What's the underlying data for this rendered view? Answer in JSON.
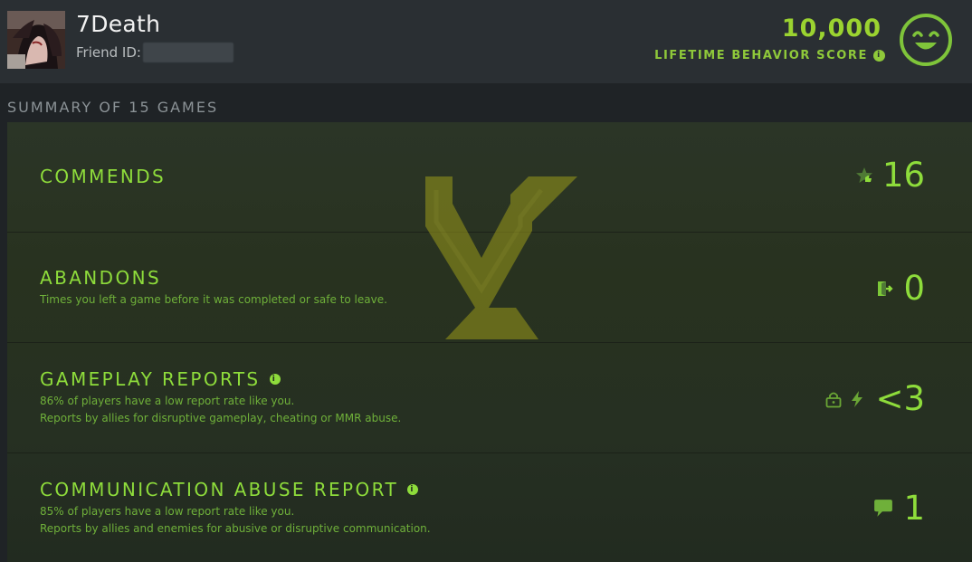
{
  "profile": {
    "name": "7Death",
    "friend_id_label": "Friend ID:",
    "avatar_icon": "player-portrait"
  },
  "behavior": {
    "score": "10,000",
    "label": "LIFETIME BEHAVIOR SCORE",
    "mood_icon": "smiley-face-icon"
  },
  "summary": {
    "title": "SUMMARY OF 15 GAMES",
    "watermark_icon": "chevron-emblem"
  },
  "cards": [
    {
      "title": "COMMENDS",
      "descriptions": [],
      "value": "16",
      "icons": [
        "star-thumbs-up-icon"
      ]
    },
    {
      "title": "ABANDONS",
      "descriptions": [
        "Times you left a game before it was completed or safe to leave."
      ],
      "value": "0",
      "icons": [
        "exit-door-icon"
      ]
    },
    {
      "title": "GAMEPLAY REPORTS",
      "descriptions": [
        "86% of players have a low report rate like you.",
        "Reports by allies for disruptive gameplay, cheating or MMR abuse."
      ],
      "value": "<3",
      "icons": [
        "lock-icon",
        "lightning-icon"
      ]
    },
    {
      "title": "COMMUNICATION ABUSE REPORT",
      "descriptions": [
        "85% of players have a low report rate like you.",
        "Reports by allies and enemies for abusive or disruptive communication."
      ],
      "value": "1",
      "icons": [
        "chat-bubble-icon"
      ]
    }
  ],
  "colors": {
    "accent": "#8edc3b",
    "score": "#9bd330",
    "description": "#6fb03a",
    "header_bg": "#2a2f33",
    "panel_bg": "#28321f",
    "watermark": "#8a8a16"
  }
}
